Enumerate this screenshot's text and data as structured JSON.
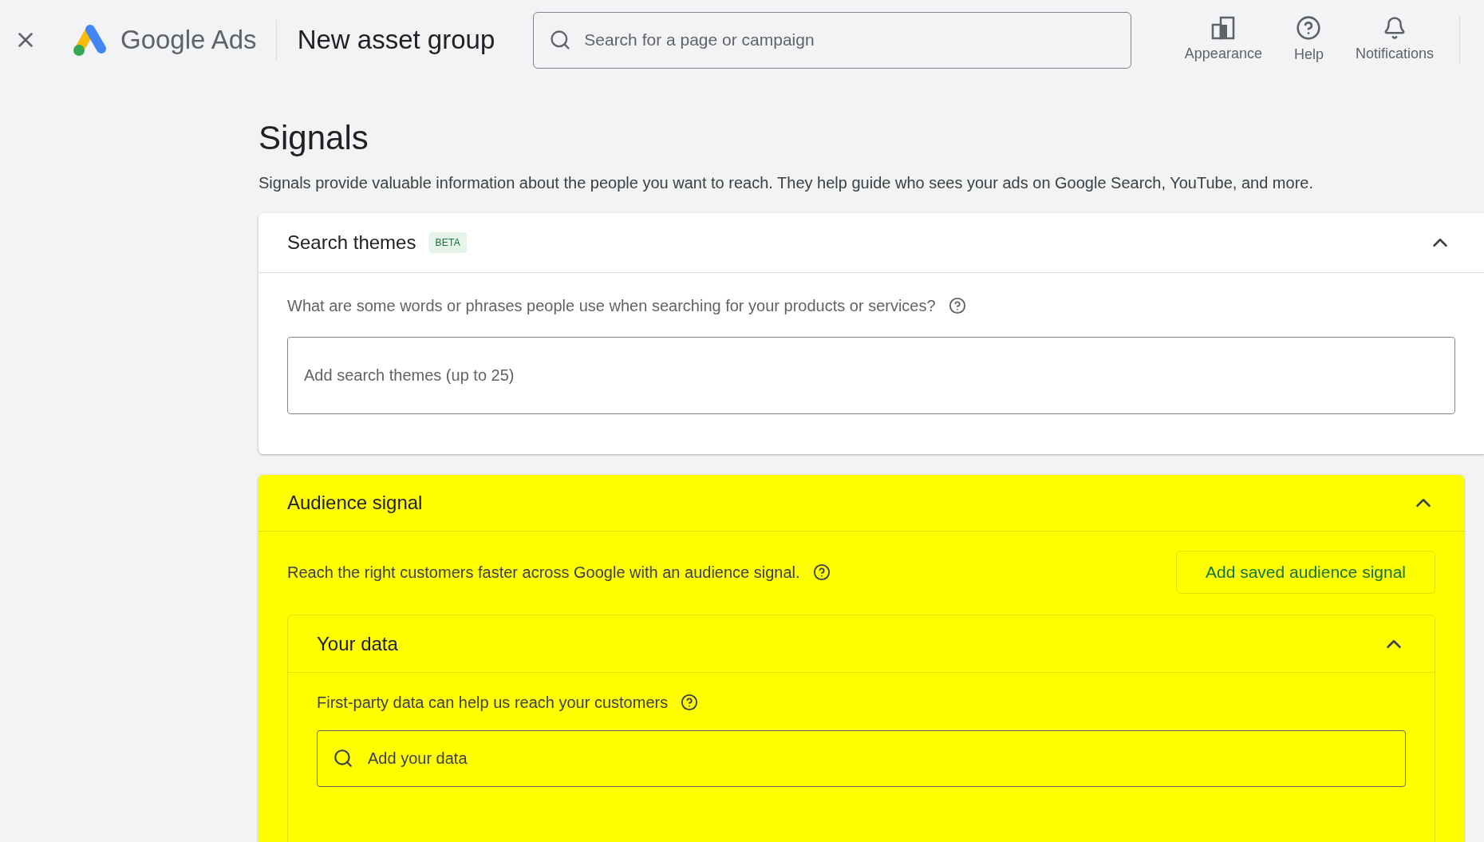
{
  "header": {
    "product": "Google Ads",
    "page_title": "New asset group",
    "search": {
      "placeholder": "Search for a page or campaign"
    },
    "actions": [
      {
        "kind": "appearance",
        "label": "Appearance"
      },
      {
        "kind": "help",
        "label": "Help"
      },
      {
        "kind": "notifications",
        "label": "Notifications"
      }
    ]
  },
  "signals": {
    "title": "Signals",
    "description": "Signals provide valuable information about the people you want to reach. They help guide who sees your ads on Google Search, YouTube, and more."
  },
  "search_themes": {
    "title": "Search themes",
    "badge": "BETA",
    "expanded": true,
    "question": "What are some words or phrases people use when searching for your products or services?",
    "input": {
      "placeholder": "Add search themes (up to 25)"
    }
  },
  "audience_signal": {
    "title": "Audience signal",
    "expanded": true,
    "highlighted": true,
    "description": "Reach the right customers faster across Google with an audience signal.",
    "button": "Add saved audience signal",
    "your_data": {
      "title": "Your data",
      "expanded": true,
      "description": "First-party data can help us reach your customers",
      "input": {
        "placeholder": "Add your data"
      }
    }
  }
}
